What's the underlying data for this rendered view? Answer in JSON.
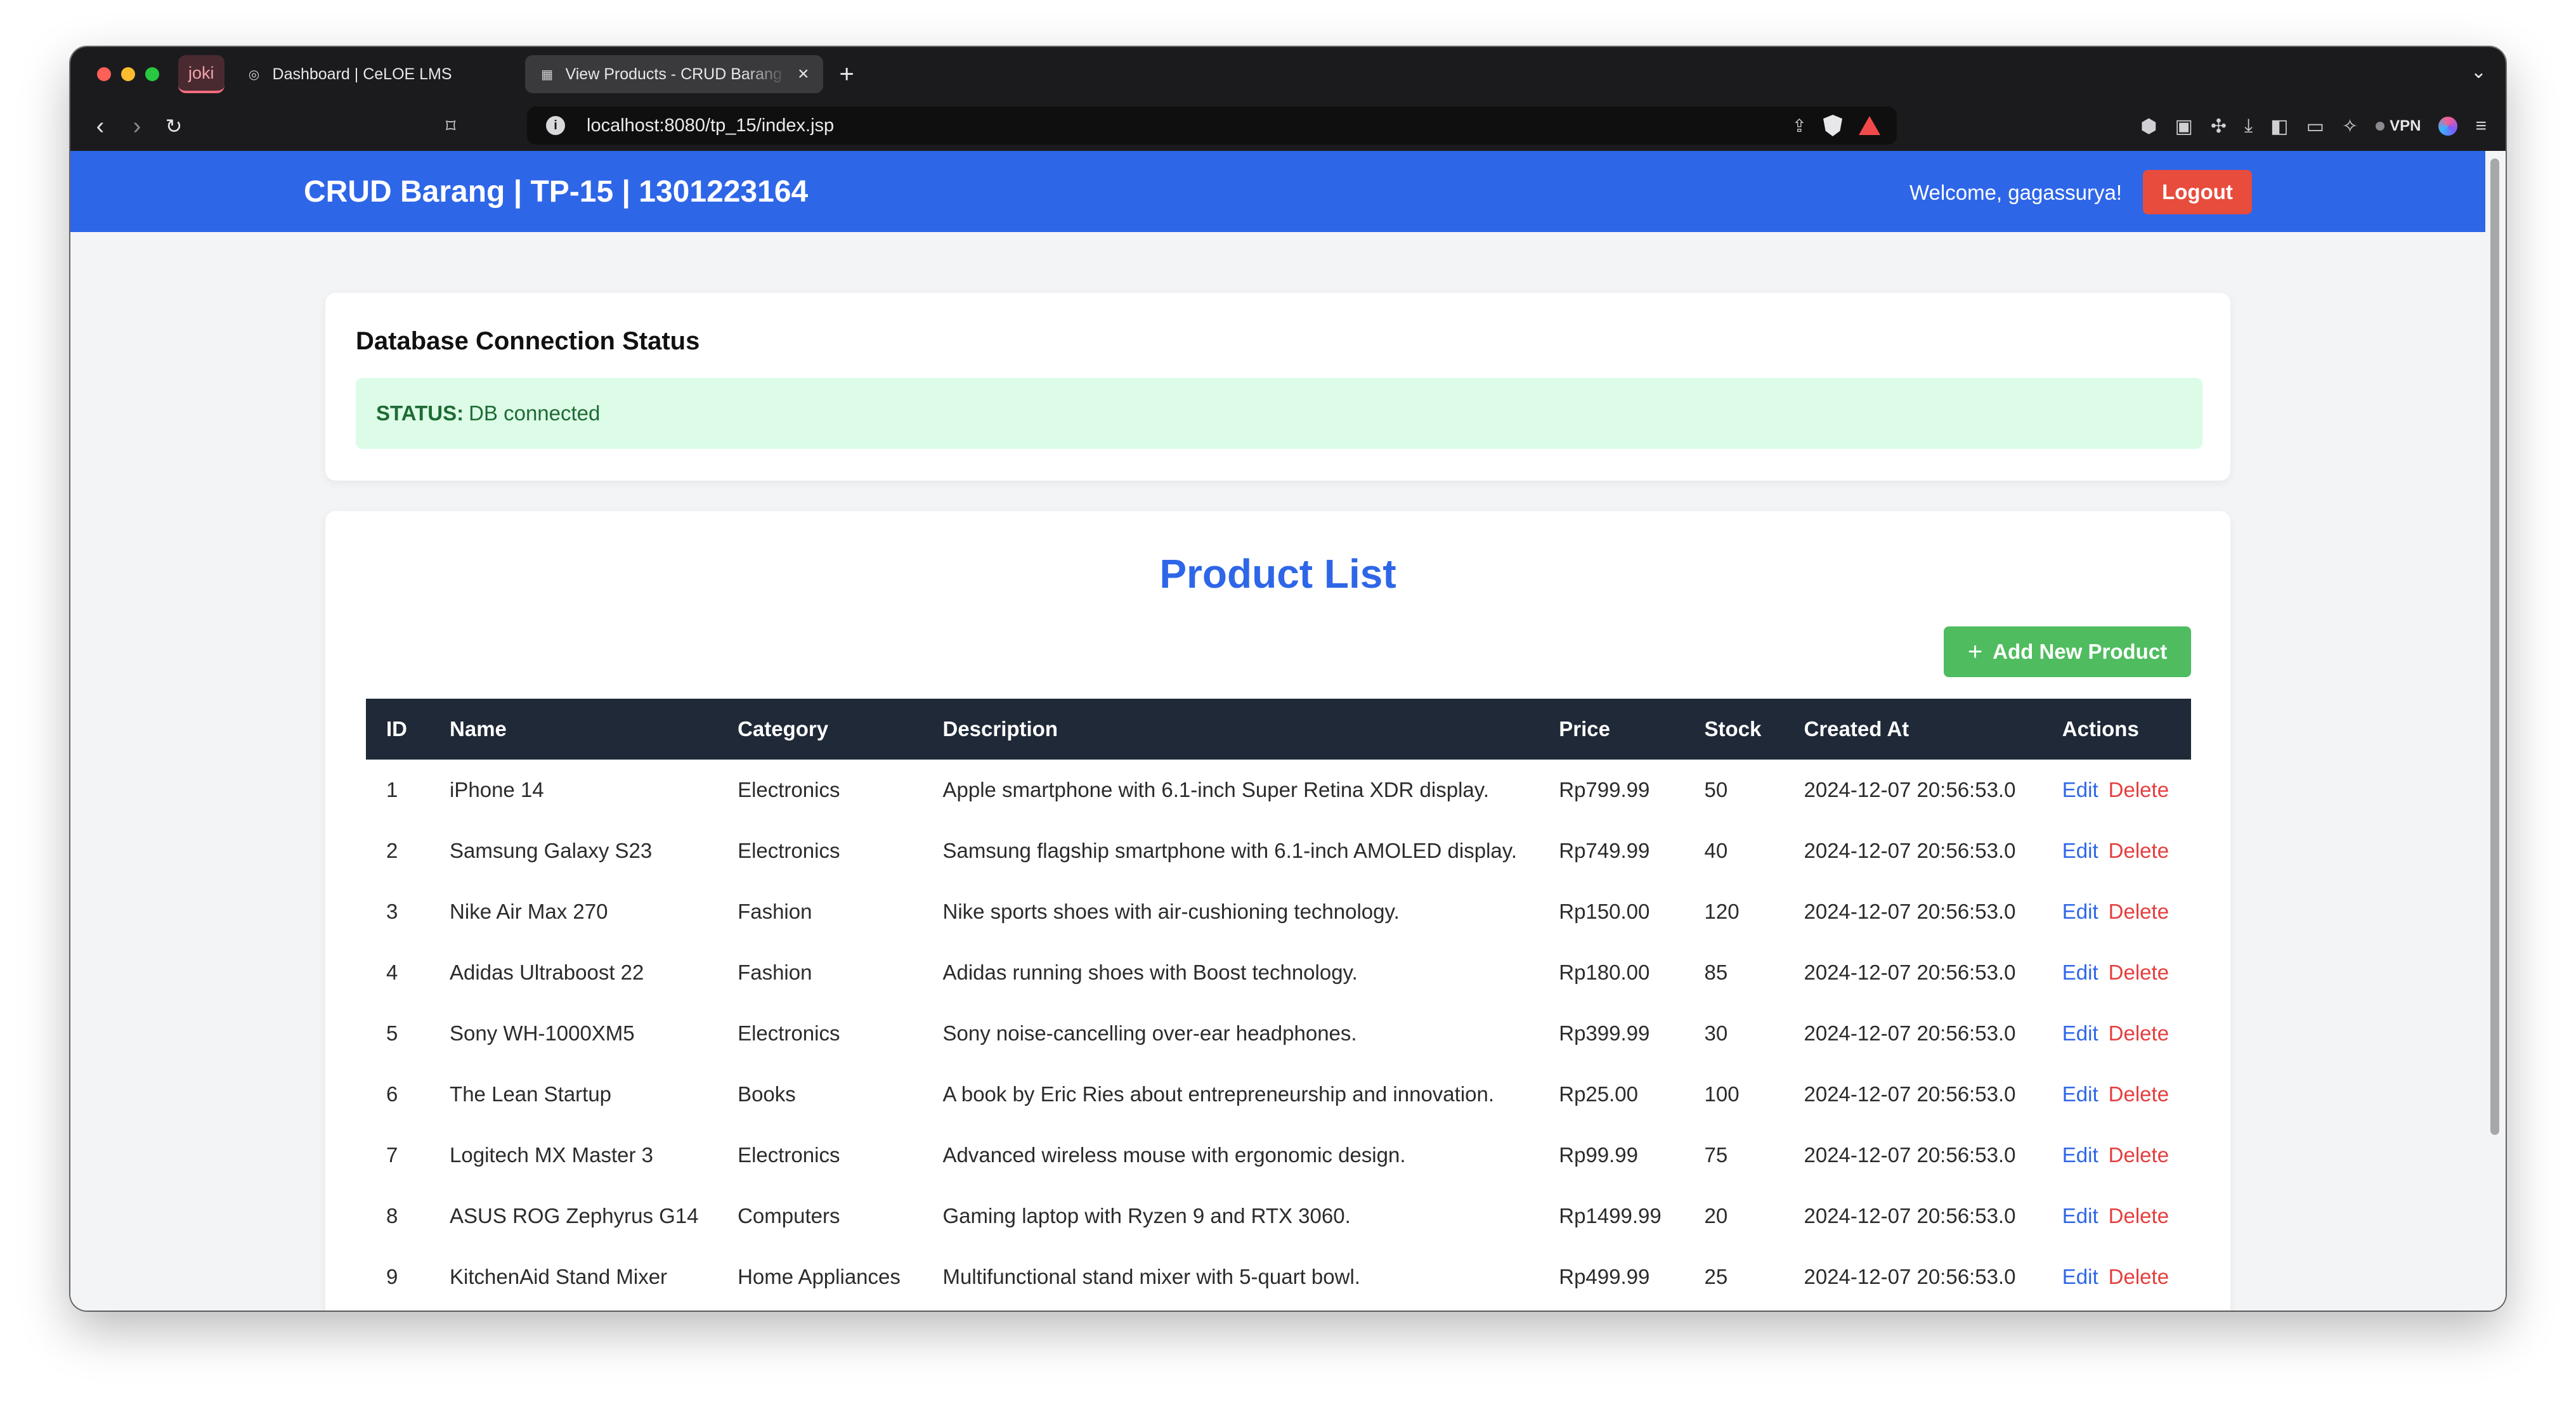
{
  "browser": {
    "tab_group_label": "joki",
    "tabs": [
      {
        "label": "Dashboard | CeLOE LMS",
        "active": false
      },
      {
        "label": "View Products - CRUD Barang | TP-15",
        "active": true
      }
    ],
    "new_tab_label": "+",
    "url": "localhost:8080/tp_15/index.jsp",
    "vpn_label": "VPN"
  },
  "header": {
    "title": "CRUD Barang | TP-15 | 1301223164",
    "welcome": "Welcome, gagassurya!",
    "logout_label": "Logout"
  },
  "status": {
    "title": "Database Connection Status",
    "label": "STATUS:",
    "value": "DB connected"
  },
  "products": {
    "title": "Product List",
    "add_label": "Add New Product",
    "columns": [
      "ID",
      "Name",
      "Category",
      "Description",
      "Price",
      "Stock",
      "Created At",
      "Actions"
    ],
    "edit_label": "Edit",
    "delete_label": "Delete",
    "rows": [
      {
        "id": "1",
        "name": "iPhone 14",
        "category": "Electronics",
        "description": "Apple smartphone with 6.1-inch Super Retina XDR display.",
        "price": "Rp799.99",
        "stock": "50",
        "created_at": "2024-12-07 20:56:53.0"
      },
      {
        "id": "2",
        "name": "Samsung Galaxy S23",
        "category": "Electronics",
        "description": "Samsung flagship smartphone with 6.1-inch AMOLED display.",
        "price": "Rp749.99",
        "stock": "40",
        "created_at": "2024-12-07 20:56:53.0"
      },
      {
        "id": "3",
        "name": "Nike Air Max 270",
        "category": "Fashion",
        "description": "Nike sports shoes with air-cushioning technology.",
        "price": "Rp150.00",
        "stock": "120",
        "created_at": "2024-12-07 20:56:53.0"
      },
      {
        "id": "4",
        "name": "Adidas Ultraboost 22",
        "category": "Fashion",
        "description": "Adidas running shoes with Boost technology.",
        "price": "Rp180.00",
        "stock": "85",
        "created_at": "2024-12-07 20:56:53.0"
      },
      {
        "id": "5",
        "name": "Sony WH-1000XM5",
        "category": "Electronics",
        "description": "Sony noise-cancelling over-ear headphones.",
        "price": "Rp399.99",
        "stock": "30",
        "created_at": "2024-12-07 20:56:53.0"
      },
      {
        "id": "6",
        "name": "The Lean Startup",
        "category": "Books",
        "description": "A book by Eric Ries about entrepreneurship and innovation.",
        "price": "Rp25.00",
        "stock": "100",
        "created_at": "2024-12-07 20:56:53.0"
      },
      {
        "id": "7",
        "name": "Logitech MX Master 3",
        "category": "Electronics",
        "description": "Advanced wireless mouse with ergonomic design.",
        "price": "Rp99.99",
        "stock": "75",
        "created_at": "2024-12-07 20:56:53.0"
      },
      {
        "id": "8",
        "name": "ASUS ROG Zephyrus G14",
        "category": "Computers",
        "description": "Gaming laptop with Ryzen 9 and RTX 3060.",
        "price": "Rp1499.99",
        "stock": "20",
        "created_at": "2024-12-07 20:56:53.0"
      },
      {
        "id": "9",
        "name": "KitchenAid Stand Mixer",
        "category": "Home Appliances",
        "description": "Multifunctional stand mixer with 5-quart bowl.",
        "price": "Rp499.99",
        "stock": "25",
        "created_at": "2024-12-07 20:56:53.0"
      }
    ]
  },
  "colors": {
    "header_bg": "#2e66e8",
    "logout_bg": "#e74c3c",
    "add_bg": "#4fbc5f",
    "status_bg": "#dcfce7",
    "table_head_bg": "#1f2937",
    "edit": "#2e66e8",
    "delete": "#e53e3e"
  }
}
